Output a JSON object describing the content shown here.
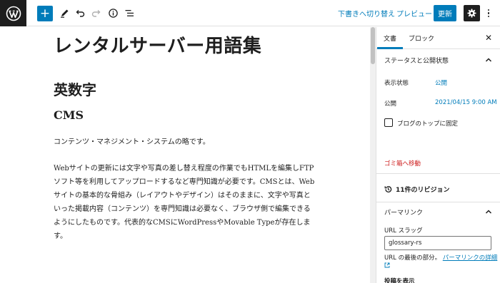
{
  "toolbar": {
    "switch_draft_label": "下書きへ切り替え",
    "preview_label": "プレビュー",
    "update_label": "更新",
    "add_symbol": "+"
  },
  "editor": {
    "post_title": "レンタルサーバー用語集",
    "heading2": "英数字",
    "heading3": "CMS",
    "paragraph1": "コンテンツ・マネジメント・システムの略です。",
    "paragraph2_lines": [
      "Webサイトの更新には文字や写真の差し替え程度の作業でもHTMLを編集しFTP",
      "ソフト等を利用してアップロードするなど専門知識が必要です。CMSとは、Web",
      "サイトの基本的な骨組み（レイアウトやデザイン）はそのままに、文字や写真と",
      "いった掲載内容（コンテンツ）を専門知識は必要なく、ブラウザ側で編集できる",
      "ようにしたものです。代表的なCMSにWordPressやMovable Typeが存在しま",
      "す。"
    ]
  },
  "sidebar": {
    "tab_document": "文書",
    "tab_block": "ブロック",
    "close_symbol": "✕",
    "status_panel_title": "ステータスと公開状態",
    "visibility_label": "表示状態",
    "visibility_value": "公開",
    "publish_label": "公開",
    "publish_value": "2021/04/15 9:00 AM",
    "sticky_label": "ブログのトップに固定",
    "trash_label": "ゴミ箱へ移動",
    "revisions_label": "11件のリビジョン",
    "permalink_title": "パーマリンク",
    "url_slug_label": "URL スラッグ",
    "url_slug_value": "glossary-rs",
    "url_help_prefix": "URL の最後の部分。",
    "url_help_link": "パーマリンクの詳細",
    "post_display_label": "投稿を表示"
  },
  "colors": {
    "accent": "#007cba",
    "danger": "#cc1818",
    "dark": "#1e1e1e"
  }
}
